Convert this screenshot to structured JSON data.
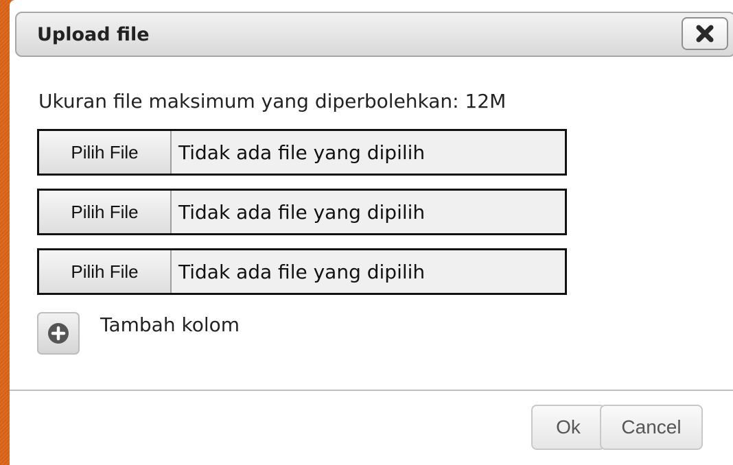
{
  "dialog": {
    "title": "Upload file",
    "close_icon": "close-icon",
    "info_text": "Ukuran file maksimum yang diperbolehkan: 12M",
    "file_inputs": [
      {
        "button_label": "Pilih File",
        "status": "Tidak ada file yang dipilih"
      },
      {
        "button_label": "Pilih File",
        "status": "Tidak ada file yang dipilih"
      },
      {
        "button_label": "Pilih File",
        "status": "Tidak ada file yang dipilih"
      }
    ],
    "add_column": {
      "icon": "plus-circle-icon",
      "label": "Tambah kolom"
    },
    "footer": {
      "ok_label": "Ok",
      "cancel_label": "Cancel"
    }
  },
  "colors": {
    "backdrop": "#d9641c",
    "titlebar": "#d9d9d9",
    "dialog_bg": "#ffffff"
  }
}
